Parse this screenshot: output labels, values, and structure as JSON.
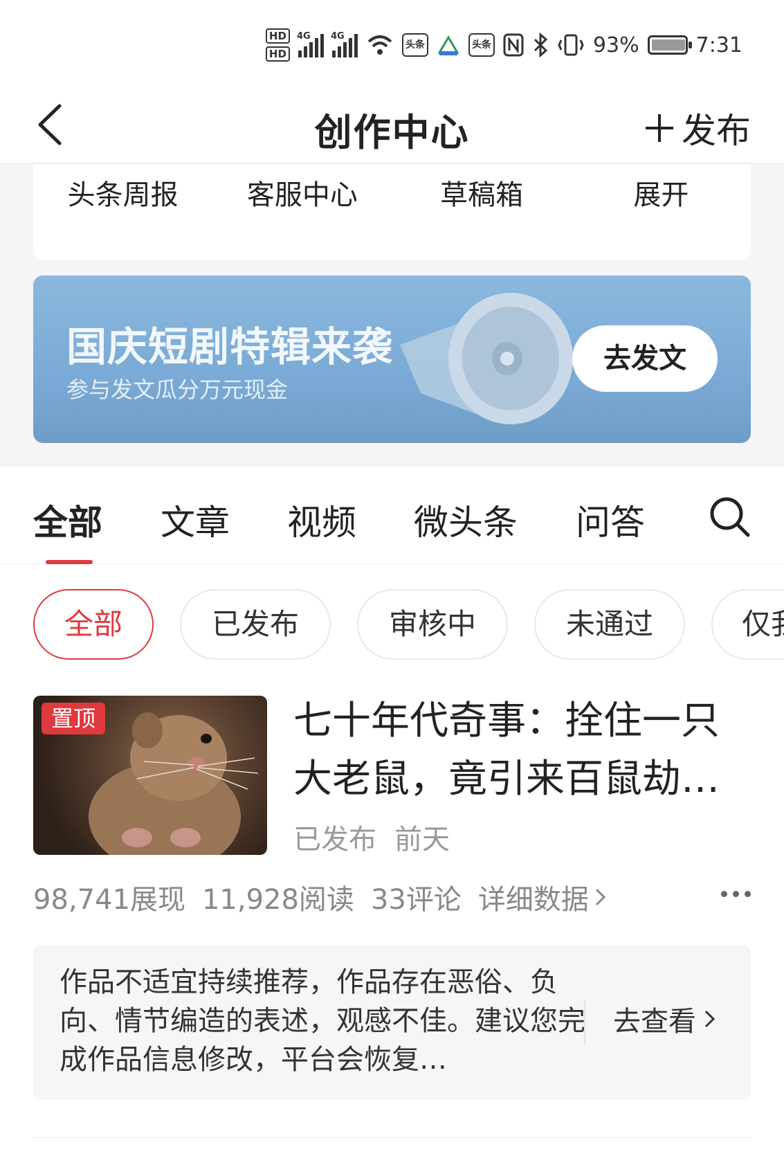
{
  "status_bar": {
    "hd1": "HD",
    "hd2": "HD",
    "sim1_type": "4G",
    "sim2_type": "4G",
    "app_badge_1": "头条",
    "app_badge_2": "头条",
    "battery": "93%",
    "time": "7:31"
  },
  "header": {
    "title": "创作中心",
    "publish_label": "发布"
  },
  "tools": [
    {
      "label": "头条周报"
    },
    {
      "label": "客服中心"
    },
    {
      "label": "草稿箱"
    },
    {
      "label": "展开"
    }
  ],
  "banner": {
    "title": "国庆短剧特辑来袭",
    "subtitle": "参与发文瓜分万元现金",
    "button": "去发文"
  },
  "tabs": [
    {
      "label": "全部",
      "active": true
    },
    {
      "label": "文章"
    },
    {
      "label": "视频"
    },
    {
      "label": "微头条"
    },
    {
      "label": "问答"
    }
  ],
  "filters": [
    {
      "label": "全部",
      "active": true
    },
    {
      "label": "已发布"
    },
    {
      "label": "审核中"
    },
    {
      "label": "未通过"
    },
    {
      "label": "仅我"
    }
  ],
  "article": {
    "pin_label": "置顶",
    "title": "七十年代奇事：拴住一只大老鼠，竟引来百鼠劫…",
    "status": "已发布",
    "time": "前天",
    "impressions": "98,741展现",
    "reads": "11,928阅读",
    "comments": "33评论",
    "detail_label": "详细数据"
  },
  "notice": {
    "text": "作品不适宜持续推荐，作品存在恶俗、负向、情节编造的表述，观感不佳。建议您完成作品信息修改，平台会恢复…",
    "link": "去查看"
  },
  "colors": {
    "accent": "#e0393e",
    "banner_bg": "#7aaad5"
  }
}
